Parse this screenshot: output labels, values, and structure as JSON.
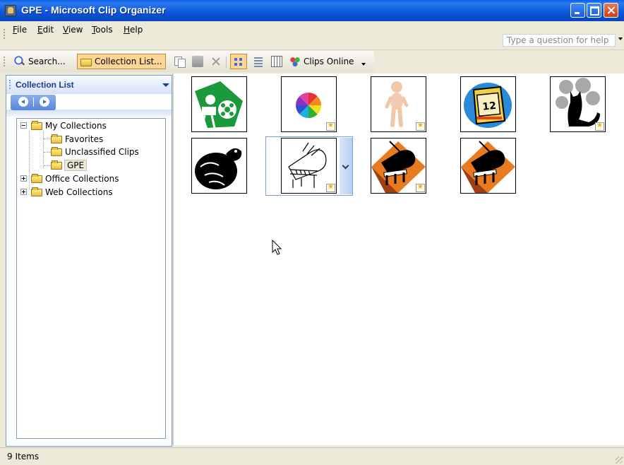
{
  "window": {
    "title": "GPE - Microsoft Clip Organizer"
  },
  "menu": {
    "items": [
      {
        "label": "File",
        "key": "F"
      },
      {
        "label": "Edit",
        "key": "E"
      },
      {
        "label": "View",
        "key": "V"
      },
      {
        "label": "Tools",
        "key": "T"
      },
      {
        "label": "Help",
        "key": "H"
      }
    ],
    "help_placeholder": "Type a question for help"
  },
  "toolbar": {
    "search_label": "Search...",
    "collection_list_label": "Collection List...",
    "clips_online_label": "Clips Online"
  },
  "taskpane": {
    "title": "Collection List",
    "tree": [
      {
        "label": "My Collections",
        "expanded": true
      },
      {
        "label": "Favorites"
      },
      {
        "label": "Unclassified Clips"
      },
      {
        "label": "GPE",
        "selected": true
      },
      {
        "label": "Office Collections",
        "expanded": false
      },
      {
        "label": "Web Collections",
        "expanded": false
      }
    ]
  },
  "clips": [
    {
      "icon": "film-projector-icon"
    },
    {
      "icon": "color-wheel-icon"
    },
    {
      "icon": "baby-photo-icon"
    },
    {
      "icon": "calendar-icon"
    },
    {
      "icon": "black-cat-icon"
    },
    {
      "icon": "turtle-icon"
    },
    {
      "icon": "piano-sketch-icon"
    },
    {
      "icon": "grand-piano-icon"
    },
    {
      "icon": "grand-piano-icon"
    }
  ],
  "status": {
    "text": "9 Items"
  },
  "colors": {
    "titlebar": "#0a55d8",
    "taskpane_border": "#7a9ad0",
    "active_button": "#ffd597"
  }
}
